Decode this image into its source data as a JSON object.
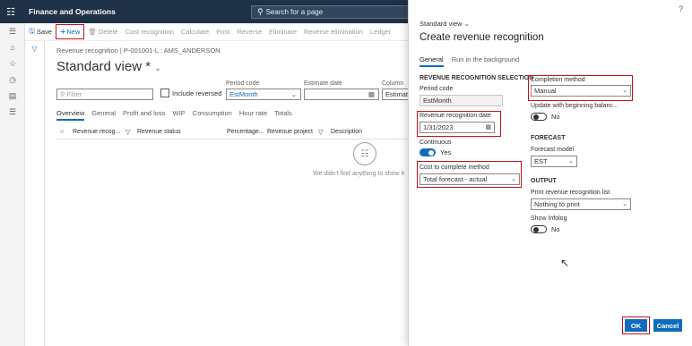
{
  "app": {
    "title": "Finance and Operations",
    "search_placeholder": "Search for a page"
  },
  "actions": {
    "save": "Save",
    "new": "New",
    "delete": "Delete",
    "cost_recognition": "Cost recognition",
    "calculate": "Calculate",
    "post": "Post",
    "reverse": "Reverse",
    "eliminate": "Eliminate",
    "reverse_elimination": "Reverse elimination",
    "ledger": "Ledger"
  },
  "page": {
    "breadcrumb": "Revenue recognition | P-001001-L : AMS_ANDERSON",
    "view_title": "Standard view *",
    "filter_placeholder": "Filter",
    "include_reversed": "Include reversed",
    "period_code_label": "Period code",
    "period_code_value": "EstMonth",
    "estimate_date_label": "Estimate date",
    "column_label": "Column",
    "column_value": "Estimat",
    "tabs": [
      "Overview",
      "General",
      "Profit and loss",
      "WIP",
      "Consumption",
      "Hour rate",
      "Totals"
    ],
    "grid_columns": [
      "Revenue recog...",
      "Revenue status",
      "Percentage...",
      "Revenue project",
      "Description"
    ],
    "empty_message": "We didn't find anything to show h"
  },
  "dialog": {
    "view_label": "Standard view",
    "title": "Create revenue recognition",
    "tabs": [
      "General",
      "Run in the background"
    ],
    "section_rrs": "REVENUE RECOGNITION SELECTION",
    "period_code_label": "Period code",
    "period_code_value": "EstMonth",
    "rr_date_label": "Revenue recognition date",
    "rr_date_value": "1/31/2023",
    "continuous_label": "Continuous",
    "continuous_value": "Yes",
    "cost_to_complete_label": "Cost to complete method",
    "cost_to_complete_value": "Total forecast - actual",
    "completion_method_label": "Completion method",
    "completion_method_value": "Manual",
    "update_label": "Update with beginning balanc...",
    "update_value": "No",
    "section_forecast": "FORECAST",
    "forecast_model_label": "Forecast model",
    "forecast_model_value": "EST",
    "section_output": "OUTPUT",
    "print_label": "Print revenue recognition list",
    "print_value": "Nothing to print",
    "show_infolog_label": "Show Infolog",
    "show_infolog_value": "No",
    "ok": "OK",
    "cancel": "Cancel",
    "help": "?"
  },
  "colors": {
    "nav": "#1f3146",
    "accent": "#0f6cbd",
    "highlight": "#c50f1f"
  }
}
